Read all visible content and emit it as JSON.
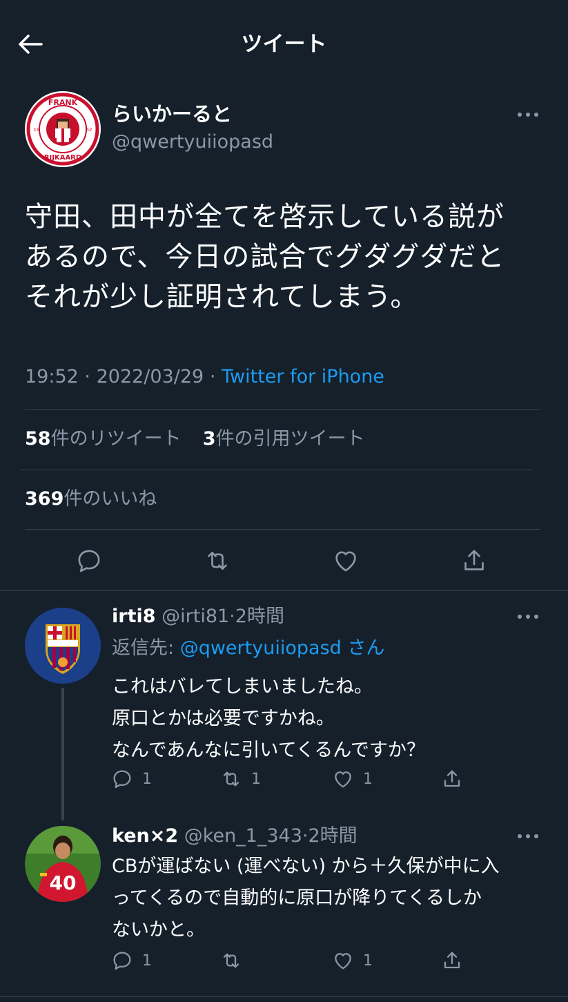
{
  "header": {
    "title": "ツイート"
  },
  "tweet": {
    "author_name": "らいかーると",
    "author_handle": "@qwertyuiiopasd",
    "avatar_top_text": "FRANK",
    "avatar_bottom_text": "RIJKAARD",
    "avatar_year_left": "19",
    "avatar_year_right": "62",
    "text": "守田、田中が全てを啓示している説が\nあるので、今日の試合でグダグダだと\nそれが少し証明されてしまう。",
    "time": "19:52",
    "date": "2022/03/29",
    "dot": "·",
    "source": "Twitter for iPhone",
    "retweets_count": "58",
    "retweets_label": "件のリツイート",
    "quotes_count": "3",
    "quotes_label": "件の引用ツイート",
    "likes_count": "369",
    "likes_label": "件のいいね"
  },
  "replies": [
    {
      "name": "irti8",
      "handle": "@irti81",
      "dot": "·",
      "time": "2時間",
      "reply_to_label": "返信先:",
      "reply_to_handle": "@qwertyuiiopasd",
      "reply_to_suffix": "さん",
      "text": "これはバレてしまいましたね。\n原口とかは必要ですかね。\nなんであんなに引いてくるんですか？",
      "replies": "1",
      "retweets": "1",
      "likes": "1"
    },
    {
      "name": "ken×2",
      "handle": "@ken_1_343",
      "dot": "·",
      "time": "2時間",
      "jersey_number": "40",
      "text": "CBが運ばない (運べない) から＋久保が中に入\nってくるので自動的に原口が降りてくるしか\nないかと。",
      "replies": "1",
      "likes": "1"
    }
  ],
  "colors": {
    "background": "#15202b",
    "accent": "#1d9bf0",
    "muted": "#8b98a5",
    "divider": "#38444d"
  }
}
